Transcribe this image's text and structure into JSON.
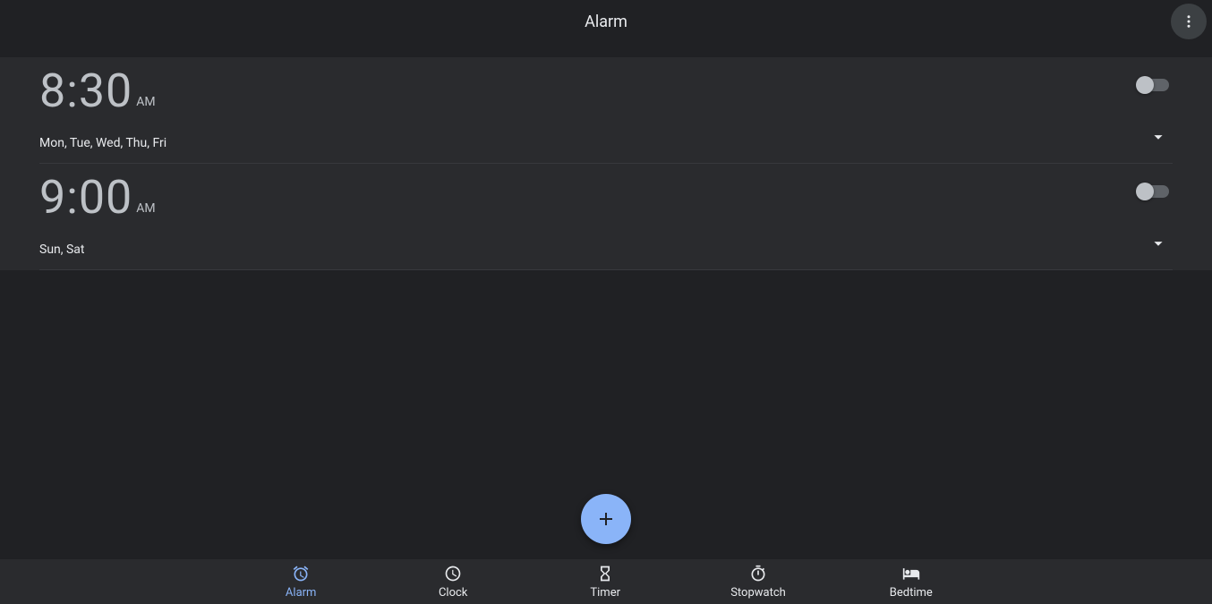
{
  "header": {
    "title": "Alarm"
  },
  "alarms": [
    {
      "time": "8:30",
      "ampm": "AM",
      "days": "Mon, Tue, Wed, Thu, Fri",
      "enabled": false
    },
    {
      "time": "9:00",
      "ampm": "AM",
      "days": "Sun, Sat",
      "enabled": false
    }
  ],
  "nav": {
    "items": [
      {
        "label": "Alarm",
        "active": true
      },
      {
        "label": "Clock",
        "active": false
      },
      {
        "label": "Timer",
        "active": false
      },
      {
        "label": "Stopwatch",
        "active": false
      },
      {
        "label": "Bedtime",
        "active": false
      }
    ]
  },
  "colors": {
    "accent": "#8ab4f8",
    "bg": "#202124",
    "surface": "#2a2b2e"
  }
}
